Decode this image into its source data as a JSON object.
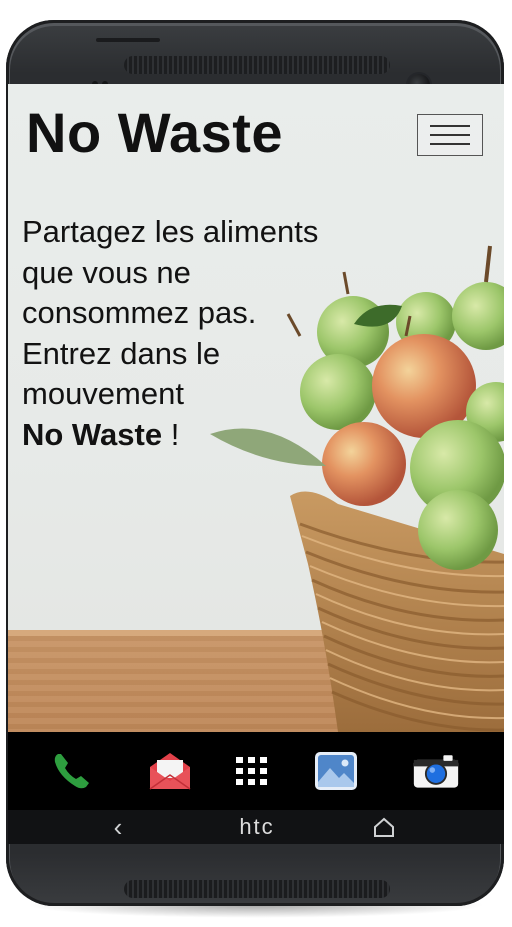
{
  "app": {
    "title": "No Waste",
    "menu_icon": "hamburger-menu-icon"
  },
  "hero": {
    "tagline_lines": [
      "Partagez les aliments",
      "que vous ne",
      "consommez pas.",
      "Entrez dans le",
      "mouvement"
    ],
    "brand_emphasis": "No Waste",
    "suffix": " !"
  },
  "dock": {
    "icons": [
      "phone-icon",
      "mail-icon",
      "app-grid-icon",
      "gallery-icon",
      "camera-icon"
    ]
  },
  "device": {
    "brand": "htc",
    "nav_icons": [
      "back-icon",
      "home-icon"
    ]
  },
  "colors": {
    "phone_green": "#2e9e3f",
    "mail_red": "#e2414a",
    "gallery_blue": "#4f86c9",
    "camera_blue": "#1f6fe0"
  }
}
